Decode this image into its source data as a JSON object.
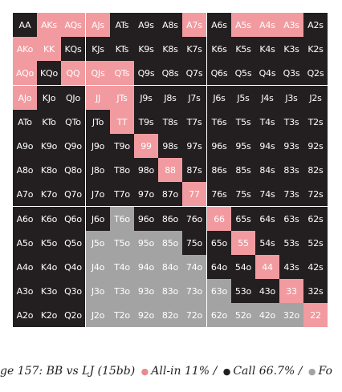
{
  "colors": {
    "fold": "#231f20",
    "allin": "#f19ba0",
    "call": "#a3a3a3"
  },
  "caption": {
    "figure": "ge 157: BB vs LJ (15bb)",
    "allin": "All-in 11% /",
    "call": "Call 66.7% /",
    "fold": "Fo"
  },
  "rows": [
    {
      "cells": [
        "AA",
        "AKs",
        "AQs",
        "AJs",
        "ATs",
        "A9s",
        "A8s",
        "A7s",
        "A6s",
        "A5s",
        "A4s",
        "A3s",
        "A2s"
      ],
      "actions": "FAAAFFFAFAAAF"
    },
    {
      "cells": [
        "AKo",
        "KK",
        "KQs",
        "KJs",
        "KTs",
        "K9s",
        "K8s",
        "K7s",
        "K6s",
        "K5s",
        "K4s",
        "K3s",
        "K2s"
      ],
      "actions": "AAFFFFFFFFFFF"
    },
    {
      "cells": [
        "AQo",
        "KQo",
        "QQ",
        "QJs",
        "QTs",
        "Q9s",
        "Q8s",
        "Q7s",
        "Q6s",
        "Q5s",
        "Q4s",
        "Q3s",
        "Q2s"
      ],
      "actions": "AFAAAFFFFFFFF"
    },
    {
      "cells": [
        "AJo",
        "KJo",
        "QJo",
        "JJ",
        "JTs",
        "J9s",
        "J8s",
        "J7s",
        "J6s",
        "J5s",
        "J4s",
        "J3s",
        "J2s"
      ],
      "actions": "AFFAAFFFFFFFF"
    },
    {
      "cells": [
        "ATo",
        "KTo",
        "QTo",
        "JTo",
        "TT",
        "T9s",
        "T8s",
        "T7s",
        "T6s",
        "T5s",
        "T4s",
        "T3s",
        "T2s"
      ],
      "actions": "FFFFAFFFFFFFF"
    },
    {
      "cells": [
        "A9o",
        "K9o",
        "Q9o",
        "J9o",
        "T9o",
        "99",
        "98s",
        "97s",
        "96s",
        "95s",
        "94s",
        "93s",
        "92s"
      ],
      "actions": "FFFFFAFFFFFFF"
    },
    {
      "cells": [
        "A8o",
        "K8o",
        "Q8o",
        "J8o",
        "T8o",
        "98o",
        "88",
        "87s",
        "86s",
        "85s",
        "84s",
        "83s",
        "82s"
      ],
      "actions": "FFFFFFAFFFFFF"
    },
    {
      "cells": [
        "A7o",
        "K7o",
        "Q7o",
        "J7o",
        "T7o",
        "97o",
        "87o",
        "77",
        "76s",
        "75s",
        "74s",
        "73s",
        "72s"
      ],
      "actions": "FFFFFFFAFFFFF"
    },
    {
      "cells": [
        "A6o",
        "K6o",
        "Q6o",
        "J6o",
        "T6o",
        "96o",
        "86o",
        "76o",
        "66",
        "65s",
        "64s",
        "63s",
        "62s"
      ],
      "actions": "FFFFCFFFAFFFF"
    },
    {
      "cells": [
        "A5o",
        "K5o",
        "Q5o",
        "J5o",
        "T5o",
        "95o",
        "85o",
        "75o",
        "65o",
        "55",
        "54s",
        "53s",
        "52s"
      ],
      "actions": "FFFCCCCFFAFFF"
    },
    {
      "cells": [
        "A4o",
        "K4o",
        "Q4o",
        "J4o",
        "T4o",
        "94o",
        "84o",
        "74o",
        "64o",
        "54o",
        "44",
        "43s",
        "42s"
      ],
      "actions": "FFFCCCCCFFAFF"
    },
    {
      "cells": [
        "A3o",
        "K3o",
        "Q3o",
        "J3o",
        "T3o",
        "93o",
        "83o",
        "73o",
        "63o",
        "53o",
        "43o",
        "33",
        "32s"
      ],
      "actions": "FFFCCCCCCFFAF"
    },
    {
      "cells": [
        "A2o",
        "K2o",
        "Q2o",
        "J2o",
        "T2o",
        "92o",
        "82o",
        "72o",
        "62o",
        "52o",
        "42o",
        "32o",
        "22"
      ],
      "actions": "FFFCCCCCCCCCA"
    }
  ]
}
